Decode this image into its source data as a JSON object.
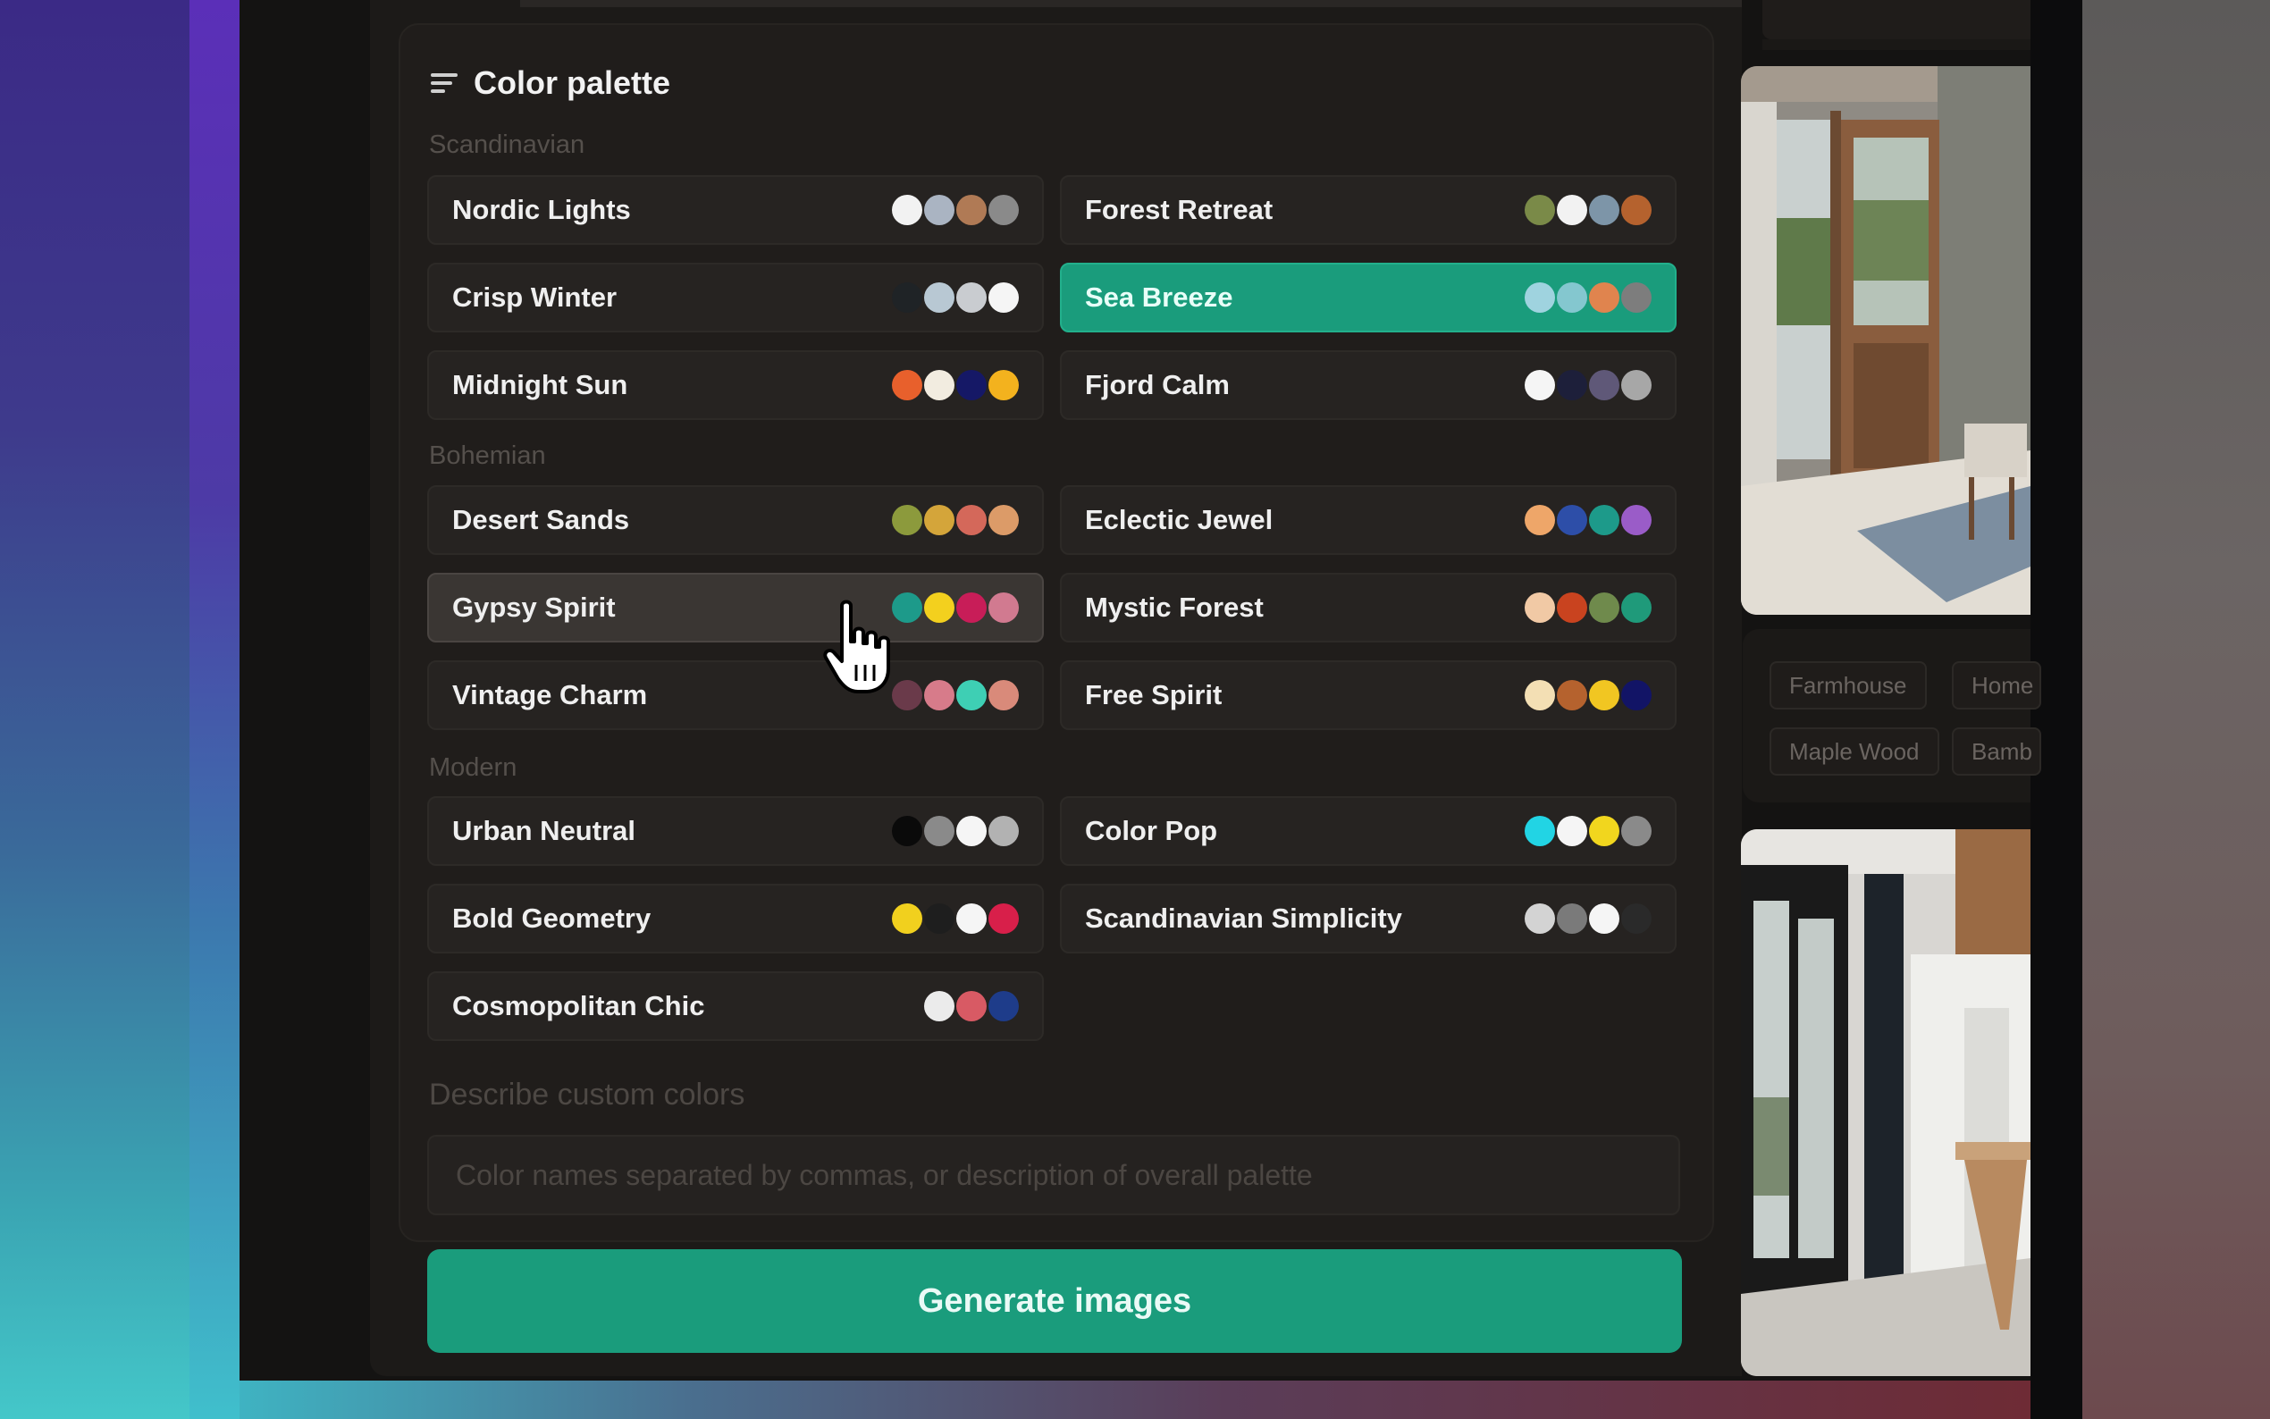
{
  "section": {
    "title": "Color palette",
    "menu_icon": "list-icon"
  },
  "groups": [
    {
      "label": "Scandinavian",
      "palettes": [
        {
          "name": "Nordic Lights",
          "colors": [
            "#f2f2f2",
            "#aab4c2",
            "#b07a55",
            "#8a8a8a"
          ]
        },
        {
          "name": "Forest Retreat",
          "colors": [
            "#7a8a48",
            "#f2f2f2",
            "#7d95a8",
            "#b5622e"
          ]
        },
        {
          "name": "Crisp Winter",
          "colors": [
            "#1f2326",
            "#b8c8d3",
            "#c9ccd0",
            "#f5f5f5"
          ]
        },
        {
          "name": "Sea Breeze",
          "colors": [
            "#9fd3df",
            "#84c7cf",
            "#e0844e",
            "#7d7d7d"
          ],
          "selected": true
        },
        {
          "name": "Midnight Sun",
          "colors": [
            "#e8602c",
            "#f2ece0",
            "#151866",
            "#f3b21e"
          ]
        },
        {
          "name": "Fjord Calm",
          "colors": [
            "#f5f5f5",
            "#1d1f3a",
            "#5f5878",
            "#a7a7a7"
          ]
        }
      ]
    },
    {
      "label": "Bohemian",
      "palettes": [
        {
          "name": "Desert Sands",
          "colors": [
            "#8c9a3c",
            "#d4a53a",
            "#d4685a",
            "#dc9b68"
          ]
        },
        {
          "name": "Eclectic Jewel",
          "colors": [
            "#eea669",
            "#2d4ea8",
            "#1d9a8a",
            "#9a5cc8"
          ]
        },
        {
          "name": "Gypsy Spirit",
          "colors": [
            "#1d9a8a",
            "#f3d01e",
            "#c81d58",
            "#d17a90"
          ],
          "hovered": true
        },
        {
          "name": "Mystic Forest",
          "colors": [
            "#f1c9a5",
            "#c9431f",
            "#6f8a4c",
            "#1f9a7a"
          ]
        },
        {
          "name": "Vintage Charm",
          "colors": [
            "#6a3a4a",
            "#d77b8a",
            "#3ecfb4",
            "#d98a7a"
          ]
        },
        {
          "name": "Free Spirit",
          "colors": [
            "#f3dfb4",
            "#b5622e",
            "#f1c622",
            "#121466"
          ]
        }
      ]
    },
    {
      "label": "Modern",
      "palettes": [
        {
          "name": "Urban Neutral",
          "colors": [
            "#0a0a0a",
            "#8a8a8a",
            "#f5f5f5",
            "#b2b2b2"
          ]
        },
        {
          "name": "Color Pop",
          "colors": [
            "#22d4e4",
            "#f5f5f5",
            "#f1d61e",
            "#8a8a8a"
          ]
        },
        {
          "name": "Bold Geometry",
          "colors": [
            "#f1d01e",
            "#1e1e1e",
            "#f5f5f5",
            "#d81f4a"
          ]
        },
        {
          "name": "Scandinavian Simplicity",
          "colors": [
            "#d3d3d3",
            "#7a7a7a",
            "#f5f5f5",
            "#2a2a2a"
          ]
        },
        {
          "name": "Cosmopolitan Chic",
          "colors": [
            "#ebebeb",
            "#d85a64",
            "#1e3c8a"
          ]
        }
      ]
    }
  ],
  "custom": {
    "label": "Describe custom colors",
    "placeholder": "Color names separated by commas, or description of overall palette",
    "value": ""
  },
  "generate_button": "Generate images",
  "right_panel": {
    "tags": [
      "Farmhouse",
      "Home",
      "Maple Wood",
      "Bamb"
    ]
  }
}
